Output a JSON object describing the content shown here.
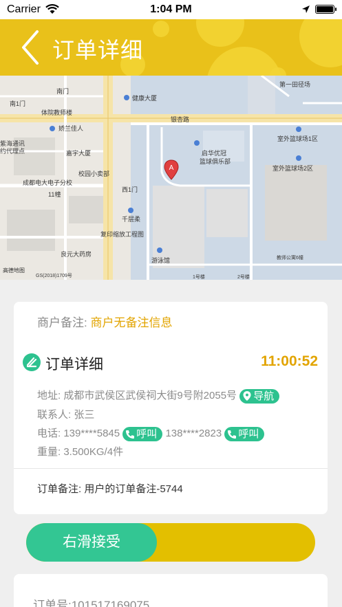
{
  "status_bar": {
    "carrier": "Carrier",
    "time": "1:04 PM"
  },
  "nav": {
    "title": "订单详细",
    "back_icon": "chevron-left-icon"
  },
  "map": {
    "labels": [
      "南门",
      "南1门",
      "体院教师楼",
      "娇兰佳人",
      "紫海通讯",
      "约代理点",
      "嘉宇大厦",
      "校园小卖部",
      "成都电大电子分校",
      "西1门",
      "千层柔",
      "复印缩放工程图",
      "良元大药房",
      "游泳馆",
      "健康大厦",
      "银杏路",
      "启华优冠",
      "篮球俱乐部",
      "第一田径场",
      "室外篮球场1区",
      "室外篮球场2区",
      "11幢",
      "1号楼",
      "2号楼",
      "教师公寓6幢",
      "GS(2018)1709号"
    ],
    "marker_label": "A",
    "logo": "高德地图"
  },
  "order": {
    "merchant_remark_label": "商户备注:",
    "merchant_remark_value": "商户无备注信息",
    "detail_title": "订单详细",
    "deadline": "11:00:52",
    "address_label": "地址:",
    "address_value": "成都市武侯区武侯祠大街9号附2055号",
    "navigate_label": "导航",
    "contact_label": "联系人:",
    "contact_value": "张三",
    "phone_label": "电话:",
    "phone1": "139****5845",
    "phone2": "138****2823",
    "call_label": "呼叫",
    "weight_label": "重量:",
    "weight_value": "3.500KG/4件",
    "order_remark": "订单备注: 用户的订单备注-5744"
  },
  "slider": {
    "label": "右滑接受"
  },
  "order_no": "订单号:101517169075",
  "colors": {
    "accent_yellow": "#e9c11a",
    "green": "#2dc28f",
    "amber_text": "#e2a400"
  }
}
